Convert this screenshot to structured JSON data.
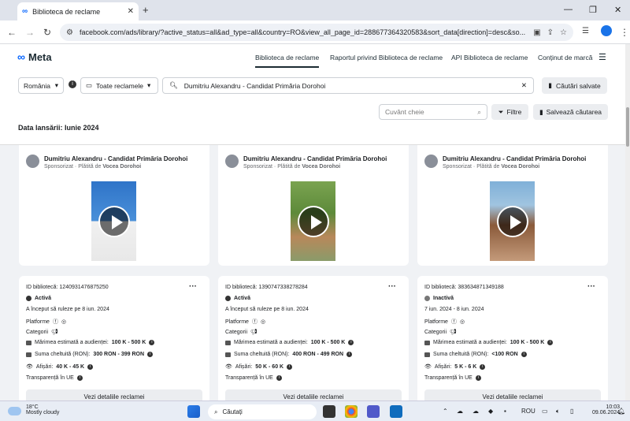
{
  "browser": {
    "tab_title": "Biblioteca de reclame",
    "url": "facebook.com/ads/library/?active_status=all&ad_type=all&country=RO&view_all_page_id=288677364320583&sort_data[direction]=desc&so..."
  },
  "header": {
    "logo": "Meta",
    "nav": [
      "Biblioteca de reclame",
      "Raportul privind Biblioteca de reclame",
      "API Biblioteca de reclame",
      "Conținut de marcă"
    ]
  },
  "filters": {
    "country": "România",
    "ad_type": "Toate reclamele",
    "search_value": "Dumitriu Alexandru - Candidat Primăria Dorohoi",
    "saved_searches": "Căutări salvate",
    "keyword_placeholder": "Cuvânt cheie",
    "filters_label": "Filtre",
    "save_search": "Salvează căutarea",
    "launch_date": "Data lansării: Iunie 2024"
  },
  "ads": [
    {
      "advertiser": "Dumitriu Alexandru - Candidat Primăria Dorohoi",
      "sponsored": "Sponsorizat",
      "paid_by_prefix": "Plătită de",
      "paid_by": "Vocea Dorohoi",
      "library_id": "ID bibliotecă: 1240931476875250",
      "status": "Activă",
      "run_info": "A început să ruleze pe 8 iun. 2024",
      "platforms": "Platforme",
      "categories": "Categorii",
      "audience_label": "Mărimea estimată a audienței:",
      "audience": "100 K - 500 K",
      "spend_label": "Suma cheltuită (RON):",
      "spend": "300 RON - 399 RON",
      "impressions_label": "Afișări:",
      "impressions": "40 K - 45 K",
      "transparency": "Transparență în UE",
      "details_button": "Vezi detaliile reclamei"
    },
    {
      "advertiser": "Dumitriu Alexandru - Candidat Primăria Dorohoi",
      "sponsored": "Sponsorizat",
      "paid_by_prefix": "Plătită de",
      "paid_by": "Vocea Dorohoi",
      "library_id": "ID bibliotecă: 1390747338278284",
      "status": "Activă",
      "run_info": "A început să ruleze pe 8 iun. 2024",
      "platforms": "Platforme",
      "categories": "Categorii",
      "audience_label": "Mărimea estimată a audienței:",
      "audience": "100 K - 500 K",
      "spend_label": "Suma cheltuită (RON):",
      "spend": "400 RON - 499 RON",
      "impressions_label": "Afișări:",
      "impressions": "50 K - 60 K",
      "transparency": "Transparență în UE",
      "details_button": "Vezi detaliile reclamei"
    },
    {
      "advertiser": "Dumitriu Alexandru - Candidat Primăria Dorohoi",
      "sponsored": "Sponsorizat",
      "paid_by_prefix": "Plătită de",
      "paid_by": "Vocea Dorohoi",
      "library_id": "ID bibliotecă: 383634871349188",
      "status": "Inactivă",
      "run_info": "7 iun. 2024 - 8 iun. 2024",
      "platforms": "Platforme",
      "categories": "Categorii",
      "audience_label": "Mărimea estimată a audienței:",
      "audience": "100 K - 500 K",
      "spend_label": "Suma cheltuită (RON):",
      "spend": "<100 RON",
      "impressions_label": "Afișări:",
      "impressions": "5 K - 6 K",
      "transparency": "Transparență în UE",
      "details_button": "Vezi detaliile reclamei"
    }
  ],
  "taskbar": {
    "temperature": "18°C",
    "weather": "Mostly cloudy",
    "search": "Căutați",
    "lang": "ROU",
    "time": "10:03",
    "date": "09.06.2024"
  }
}
